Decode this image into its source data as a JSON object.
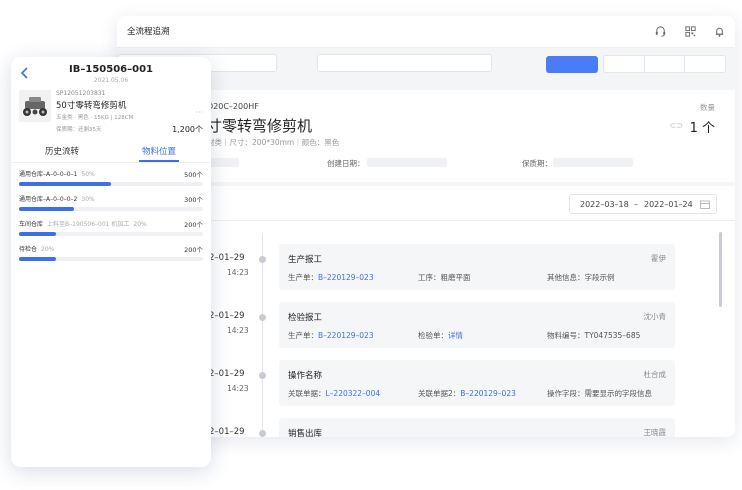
{
  "desktop": {
    "title": "全流程追溯",
    "product": {
      "code": "D20C–200HF",
      "name": "寸零转弯修剪机",
      "spec": "材类｜尺寸：200*30mm｜颜色：黑色",
      "qty_label": "数量",
      "qty_value": "1 个",
      "meta_labels": [
        "创建日期：",
        "保质期："
      ]
    },
    "date_range": {
      "start": "2022–03–18",
      "sep": "–",
      "end": "2022–01–24"
    },
    "timeline": [
      {
        "date": "2–01–29",
        "time": "14:23",
        "title": "生产报工",
        "person": "霍伊",
        "fields": [
          {
            "label": "生产单：",
            "value": "B–220129–023",
            "link": true
          },
          {
            "label": "工序：",
            "value": "粗磨平面",
            "link": false
          },
          {
            "label": "其他信息：",
            "value": "字段示例",
            "link": false
          }
        ]
      },
      {
        "date": "2–01–29",
        "time": "14:23",
        "title": "检验报工",
        "person": "沈小青",
        "fields": [
          {
            "label": "生产单：",
            "value": "B–220129–023",
            "link": true
          },
          {
            "label": "检验单：",
            "value": "详情",
            "link": true
          },
          {
            "label": "物料编号：",
            "value": "TY047535–685",
            "link": false
          }
        ]
      },
      {
        "date": "2–01–29",
        "time": "14:23",
        "title": "操作名称",
        "person": "杜合成",
        "fields": [
          {
            "label": "关联单据：",
            "value": "L–220322–004",
            "link": true
          },
          {
            "label": "关联单据2：",
            "value": "B–220129–023",
            "link": true
          },
          {
            "label": "操作字段：",
            "value": "需要显示的字段信息",
            "link": false
          }
        ]
      },
      {
        "date": "2–01–29",
        "time": "",
        "title": "销售出库",
        "person": "王晓霞",
        "fields": []
      }
    ]
  },
  "mobile": {
    "title": "IB–150506–001",
    "date": "2021.05.06",
    "code": "SP12051203831",
    "name": "50寸零转弯修剪机",
    "spec": "五金类 · 黑色 · 15KG | 128CM",
    "more": "···",
    "shelf": "保质期：还剩35天",
    "count": "1,200个",
    "tabs": [
      "历史流转",
      "物料位置"
    ],
    "locations": [
      {
        "name": "通用仓库–A–0–0–0–1",
        "pct": "50%",
        "count": "500个",
        "fill": 0.5
      },
      {
        "name": "通用仓库–A–0–0–0–2",
        "pct": "30%",
        "count": "300个",
        "fill": 0.3
      },
      {
        "name": "车间仓库",
        "extra": "上料至B–190506–001 机加工",
        "pct": "20%",
        "count": "200个",
        "fill": 0.2
      },
      {
        "name": "待检仓",
        "pct": "20%",
        "count": "200个",
        "fill": 0.2
      }
    ]
  }
}
